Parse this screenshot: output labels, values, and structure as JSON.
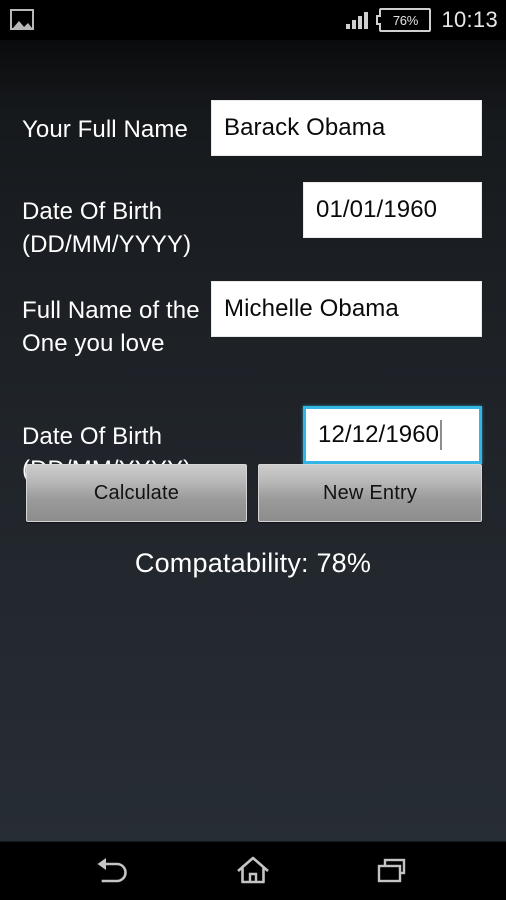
{
  "status_bar": {
    "notification_icon": "gallery-icon",
    "signal_icon": "signal-bars-icon",
    "battery_level": "76%",
    "clock": "10:13"
  },
  "form": {
    "fields": [
      {
        "label": "Your Full Name",
        "value": "Barack Obama",
        "focused": false
      },
      {
        "label": "Date Of Birth (DD/MM/YYYY)",
        "value": "01/01/1960",
        "focused": false
      },
      {
        "label": "Full Name of the One you love",
        "value": "Michelle Obama",
        "focused": false
      },
      {
        "label": "Date Of Birth (DD/MM/YYYY)",
        "value": "12/12/1960",
        "focused": true
      }
    ]
  },
  "buttons": {
    "calculate": "Calculate",
    "new_entry": "New Entry"
  },
  "result": {
    "text": "Compatability: 78%"
  },
  "nav_bar": {
    "back": "back-icon",
    "home": "home-icon",
    "recent": "recent-apps-icon"
  },
  "colors": {
    "focus_accent": "#33b5e5",
    "background_top": "#0a0b0c",
    "background_bottom": "#272d34",
    "field_background": "#ffffff",
    "label_text": "#ffffff",
    "button_face": "#b9b9b9"
  }
}
